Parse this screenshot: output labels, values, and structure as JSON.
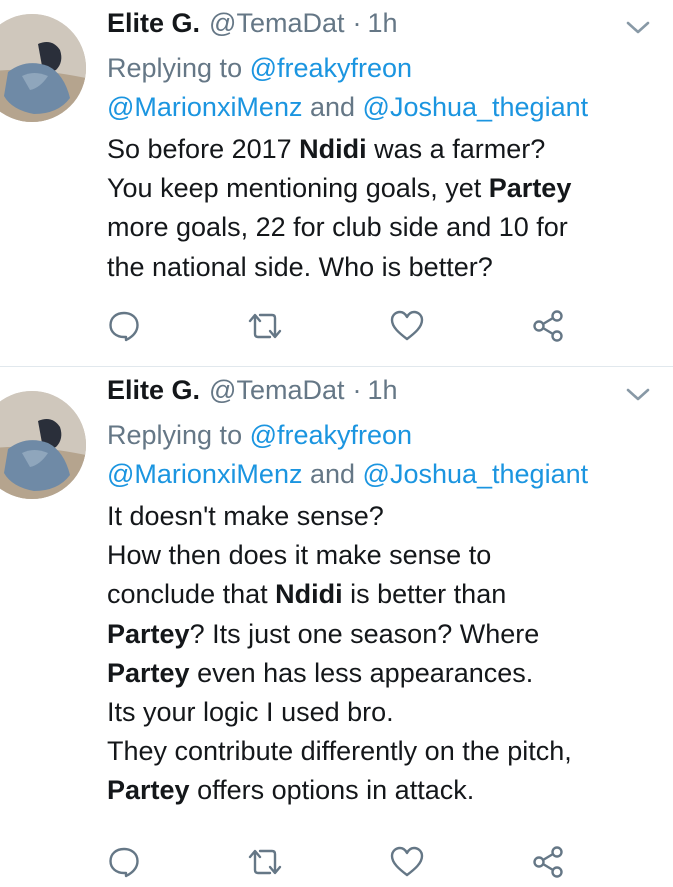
{
  "tweets": [
    {
      "author": {
        "name": "Elite G.",
        "handle": "@TemaDat",
        "separator": "·",
        "time": "1h"
      },
      "reply": {
        "prefix": "Replying to ",
        "mention_1": "@freakyfreon",
        "mention_2": "@MarionxiMenz",
        "conjunction": " and ",
        "mention_3": "@Joshua_thegiant"
      },
      "lines": [
        [
          {
            "text": "So before 2017 "
          },
          {
            "text": "Ndidi",
            "bold": true
          },
          {
            "text": " was a farmer?"
          }
        ],
        [
          {
            "text": "You keep mentioning goals, yet "
          },
          {
            "text": "Partey",
            "bold": true
          }
        ],
        [
          {
            "text": "more goals, 22 for club side and 10 for"
          }
        ],
        [
          {
            "text": "the national side. Who is better?"
          }
        ]
      ],
      "icons": {
        "reply": "reply-icon",
        "retweet": "retweet-icon",
        "like": "heart-icon",
        "share": "share-icon",
        "menu": "chevron-down-icon"
      }
    },
    {
      "author": {
        "name": "Elite G.",
        "handle": "@TemaDat",
        "separator": "·",
        "time": "1h"
      },
      "reply": {
        "prefix": "Replying to ",
        "mention_1": "@freakyfreon",
        "mention_2": "@MarionxiMenz",
        "conjunction": " and ",
        "mention_3": "@Joshua_thegiant"
      },
      "lines": [
        [
          {
            "text": "It doesn't make sense?"
          }
        ],
        [
          {
            "text": "How then does it make sense to"
          }
        ],
        [
          {
            "text": "conclude that "
          },
          {
            "text": "Ndidi",
            "bold": true
          },
          {
            "text": " is better than"
          }
        ],
        [
          {
            "text": "Partey",
            "bold": true
          },
          {
            "text": "? Its just one season? Where"
          }
        ],
        [
          {
            "text": "Partey",
            "bold": true
          },
          {
            "text": " even has less appearances."
          }
        ],
        [
          {
            "text": "Its your logic I used bro."
          }
        ],
        [
          {
            "text": "They contribute differently on the pitch,"
          }
        ],
        [
          {
            "text": "Partey",
            "bold": true
          },
          {
            "text": " offers options in attack."
          }
        ]
      ],
      "icons": {
        "reply": "reply-icon",
        "retweet": "retweet-icon",
        "like": "heart-icon",
        "share": "share-icon",
        "menu": "chevron-down-icon"
      }
    }
  ],
  "colors": {
    "text": "#14171a",
    "secondary": "#657786",
    "link": "#1b95e0",
    "divider": "#e1e8ed",
    "icon": "#657786"
  }
}
